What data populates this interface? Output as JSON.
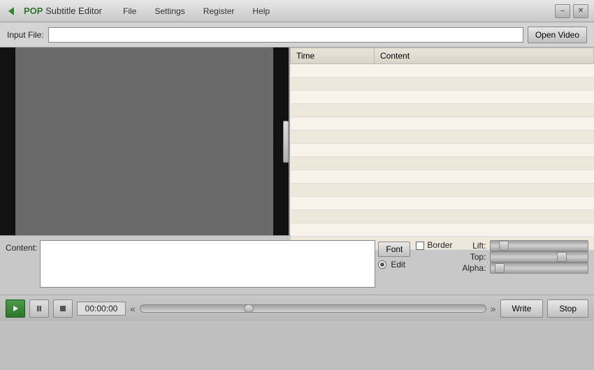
{
  "titlebar": {
    "app_name": "POP Subtitle Editor",
    "app_pop": "POP",
    "app_rest": " Subtitle Editor",
    "menus": [
      "File",
      "Settings",
      "Register",
      "Help"
    ],
    "min_btn": "–",
    "close_btn": "✕"
  },
  "input_bar": {
    "label": "Input File:",
    "placeholder": "",
    "open_btn": "Open Video"
  },
  "subtitle_table": {
    "columns": [
      "Time",
      "Content"
    ],
    "rows": []
  },
  "content_area": {
    "label": "Content:",
    "font_btn": "Font",
    "edit_label": "Edit",
    "border_label": "Border"
  },
  "sliders": {
    "lift_label": "Lift:",
    "top_label": "Top:",
    "alpha_label": "Alpha:",
    "lift_value": 10,
    "top_value": 70,
    "alpha_value": 5
  },
  "transport": {
    "time": "00:00:00",
    "write_btn": "Write",
    "stop_btn": "Stop"
  }
}
